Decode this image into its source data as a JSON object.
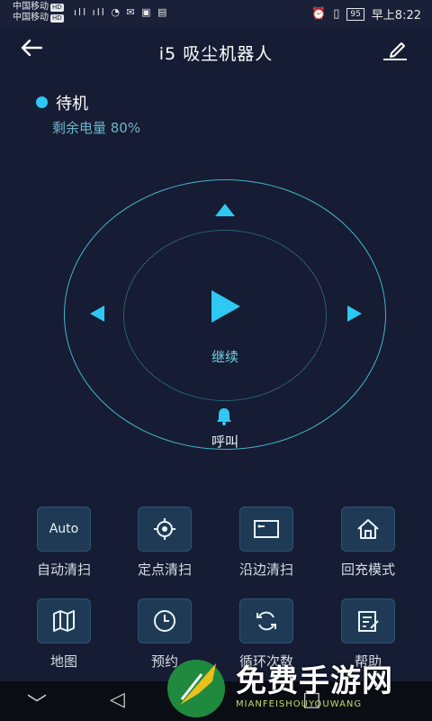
{
  "status_bar": {
    "carrier1": "中国移动",
    "carrier2": "中国移动",
    "hd": "HD",
    "battery": "95",
    "time": "早上8:22"
  },
  "header": {
    "title": "i5 吸尘机器人"
  },
  "device": {
    "state": "待机",
    "battery": "剩余电量 80%"
  },
  "control": {
    "continue_label": "继续",
    "call_label": "呼叫"
  },
  "grid": {
    "auto_icon_text": "Auto",
    "items": [
      {
        "label": "自动清扫"
      },
      {
        "label": "定点清扫"
      },
      {
        "label": "沿边清扫"
      },
      {
        "label": "回充模式"
      },
      {
        "label": "地图"
      },
      {
        "label": "预约"
      },
      {
        "label": "循环次数"
      },
      {
        "label": "帮助"
      }
    ]
  },
  "watermark": {
    "text": "免费手游网",
    "sub": "MIANFEISHOUYOUWANG"
  },
  "colors": {
    "background": "#161c33",
    "accent": "#2ec8f2"
  }
}
